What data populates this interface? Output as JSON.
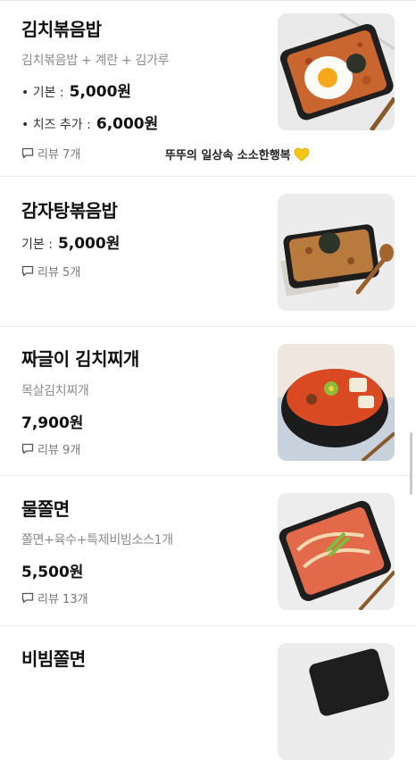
{
  "items": [
    {
      "name": "김치볶음밥",
      "description": "김치볶음밥 + 계란 + 김가루",
      "prices": [
        {
          "label": "• 기본 :",
          "value": "5,000원"
        },
        {
          "label": "• 치즈 추가 :",
          "value": "6,000원"
        }
      ],
      "review": "리뷰 7개"
    },
    {
      "name": "감자탕볶음밥",
      "prices": [
        {
          "label": "기본 :",
          "value": "5,000원"
        }
      ],
      "review": "리뷰 5개"
    },
    {
      "name": "짜글이 김치찌개",
      "description": "목살김치찌개",
      "price": "7,900원",
      "review": "리뷰 9개"
    },
    {
      "name": "물쫄면",
      "description": "쫄면+육수+특제비빔소스1개",
      "price": "5,500원",
      "review": "리뷰 13개"
    },
    {
      "name": "비빔쫄면"
    }
  ],
  "caption": "뚜뚜의 일상속 소소한행복",
  "icons": {
    "review": "speech-bubble-icon",
    "caption": "yellow-heart-icon"
  },
  "colors": {
    "heart": "#f5c518",
    "text_muted": "#8a8a8a"
  }
}
